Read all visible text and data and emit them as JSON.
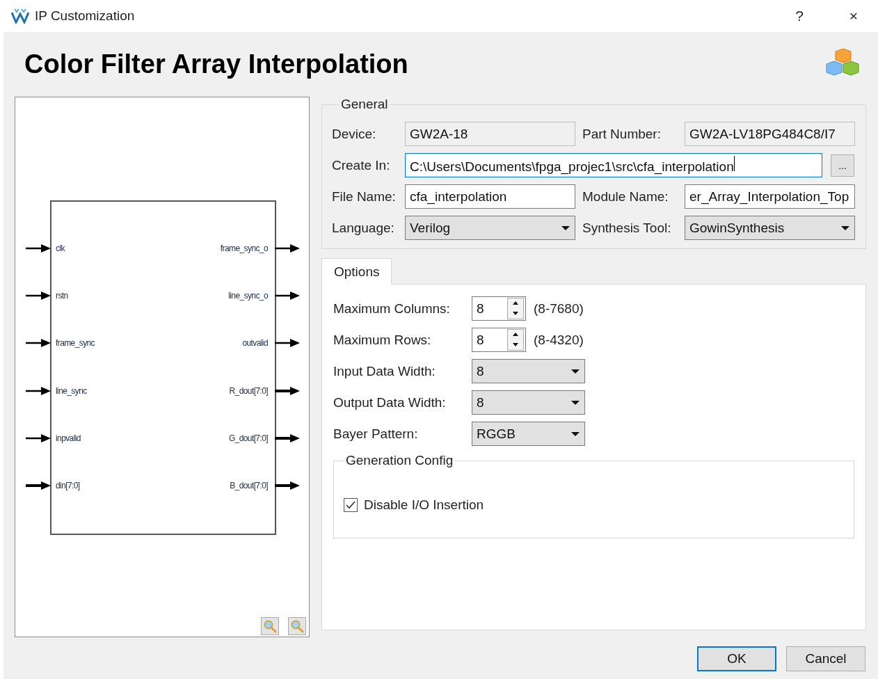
{
  "window": {
    "title": "IP Customization",
    "help": "?",
    "close": "×"
  },
  "heading": "Color Filter Array Interpolation",
  "schematic": {
    "inputs": [
      {
        "label": "clk",
        "bus": false
      },
      {
        "label": "rstn",
        "bus": false
      },
      {
        "label": "frame_sync",
        "bus": false
      },
      {
        "label": "line_sync",
        "bus": false
      },
      {
        "label": "inpvalid",
        "bus": false
      },
      {
        "label": "din[7:0]",
        "bus": true
      }
    ],
    "outputs": [
      {
        "label": "frame_sync_o",
        "bus": false
      },
      {
        "label": "line_sync_o",
        "bus": false
      },
      {
        "label": "outvalid",
        "bus": false
      },
      {
        "label": "R_dout[7:0]",
        "bus": true
      },
      {
        "label": "G_dout[7:0]",
        "bus": true
      },
      {
        "label": "B_dout[7:0]",
        "bus": true
      }
    ]
  },
  "general": {
    "title": "General",
    "rows": [
      [
        {
          "label": "Device:",
          "kind": "readonly",
          "value": "GW2A-18"
        },
        {
          "label": "Part Number:",
          "kind": "readonly",
          "value": "GW2A-LV18PG484C8/I7"
        }
      ],
      [
        {
          "label": "Create In:",
          "kind": "text",
          "value": "C:\\Users\\Documents\\fpga_projec1\\src\\cfa_interpolation",
          "focused": true,
          "browse": "..."
        }
      ],
      [
        {
          "label": "File Name:",
          "kind": "text",
          "value": "cfa_interpolation",
          "focused": false
        },
        {
          "label": "Module Name:",
          "kind": "text",
          "value": "er_Array_Interpolation_Top",
          "focused": false
        }
      ],
      [
        {
          "label": "Language:",
          "kind": "select",
          "value": "Verilog"
        },
        {
          "label": "Synthesis Tool:",
          "kind": "select",
          "value": "GowinSynthesis"
        }
      ]
    ]
  },
  "tabs": [
    {
      "label": "Options",
      "selected": true
    }
  ],
  "options": {
    "fields": [
      {
        "label": "Maximum Columns:",
        "kind": "spin",
        "value": "8",
        "range": "(8-7680)"
      },
      {
        "label": "Maximum Rows:",
        "kind": "spin",
        "value": "8",
        "range": "(8-4320)"
      },
      {
        "label": "Input Data Width:",
        "kind": "select",
        "value": "8"
      },
      {
        "label": "Output Data Width:",
        "kind": "select",
        "value": "8"
      },
      {
        "label": "Bayer Pattern:",
        "kind": "select",
        "value": "RGGB"
      }
    ],
    "generation_config": {
      "title": "Generation Config",
      "checkbox": {
        "label": "Disable I/O Insertion",
        "checked": true
      }
    }
  },
  "buttons": [
    {
      "label": "OK",
      "default": true
    },
    {
      "label": "Cancel",
      "default": false
    }
  ]
}
